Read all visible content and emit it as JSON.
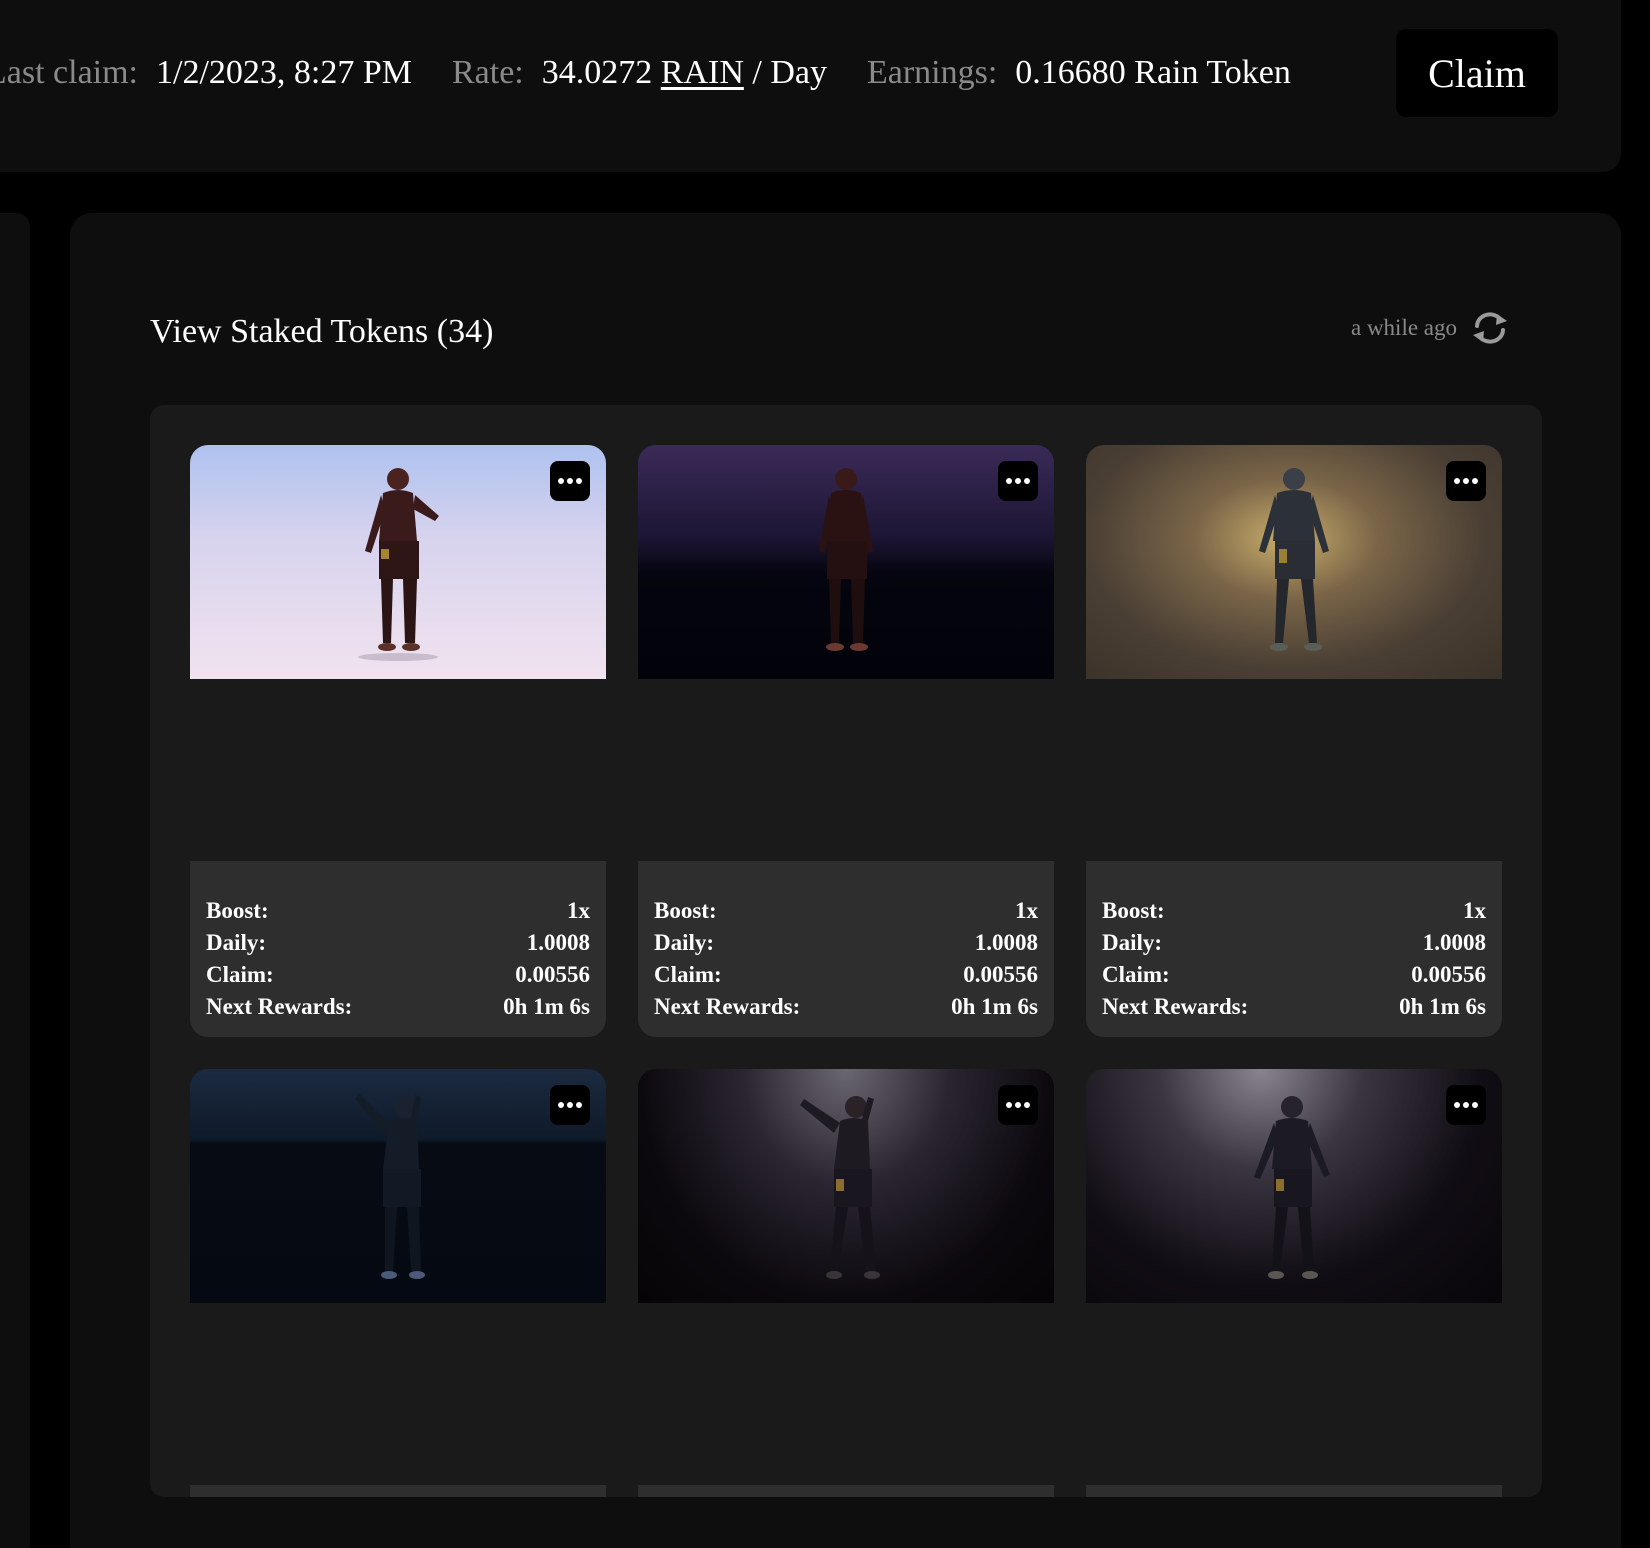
{
  "header": {
    "last_claim_label": "Last claim:",
    "last_claim_value": "1/2/2023, 8:27 PM",
    "rate_label": "Rate:",
    "rate_number": "34.0272",
    "rate_token": "RAIN",
    "rate_suffix": "/ Day",
    "earnings_label": "Earnings:",
    "earnings_value": "0.16680 Rain Token",
    "claim_label": "Claim"
  },
  "section": {
    "title": "View Staked Tokens (34)",
    "updated": "a while ago"
  },
  "stat_labels": {
    "boost": "Boost:",
    "daily": "Daily:",
    "claim": "Claim:",
    "next": "Next Rewards:"
  },
  "tokens": [
    {
      "boost": "1x",
      "daily": "1.0008",
      "claim": "0.00556",
      "next": "0h 1m 6s"
    },
    {
      "boost": "1x",
      "daily": "1.0008",
      "claim": "0.00556",
      "next": "0h 1m 6s"
    },
    {
      "boost": "1x",
      "daily": "1.0008",
      "claim": "0.00556",
      "next": "0h 1m 6s"
    },
    {},
    {},
    {}
  ],
  "icons": {
    "refresh": "refresh-icon",
    "more": "more-options-icon"
  },
  "colors": {
    "background": "#000000",
    "panel": "#0e0e0e",
    "grid": "#1a1a1a",
    "card_stats": "#2e2e2e",
    "muted_text": "#8a8a8a"
  }
}
